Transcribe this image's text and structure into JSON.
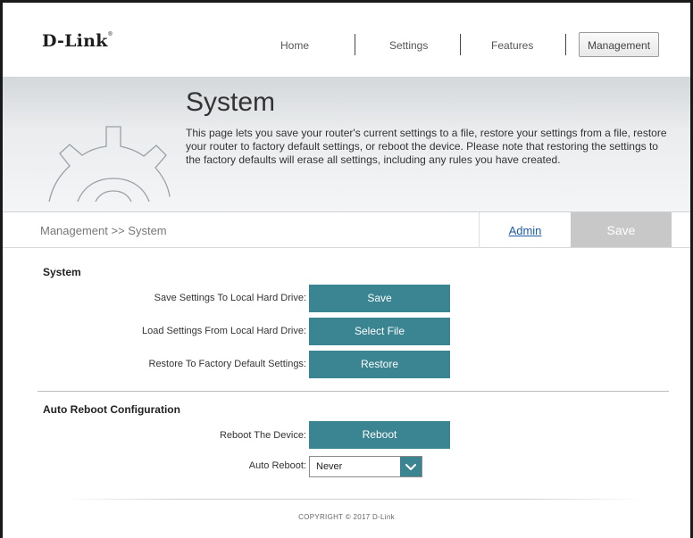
{
  "header": {
    "logo": "D-Link",
    "nav": [
      {
        "label": "Home"
      },
      {
        "label": "Settings"
      },
      {
        "label": "Features"
      },
      {
        "label": "Management"
      }
    ]
  },
  "banner": {
    "title": "System",
    "description": "This page lets you save your router's current settings to a file, restore your settings from a file, restore your router to factory default settings, or reboot the device. Please note that restoring the settings to the factory defaults will erase all settings, including any rules you have created."
  },
  "breadcrumb": {
    "path": "Management >> System",
    "admin_tab": "Admin",
    "save_tab": "Save"
  },
  "system": {
    "title": "System",
    "rows": [
      {
        "label": "Save Settings To Local Hard Drive:",
        "button": "Save"
      },
      {
        "label": "Load Settings From Local Hard Drive:",
        "button": "Select File"
      },
      {
        "label": "Restore To Factory Default Settings:",
        "button": "Restore"
      }
    ]
  },
  "auto_reboot": {
    "title": "Auto Reboot Configuration",
    "reboot_label": "Reboot The Device:",
    "reboot_button": "Reboot",
    "auto_label": "Auto Reboot:",
    "auto_value": "Never"
  },
  "footer": {
    "copyright": "COPYRIGHT © 2017 D-Link"
  },
  "colors": {
    "accent": "#3a8591",
    "link": "#1a5aa8"
  }
}
